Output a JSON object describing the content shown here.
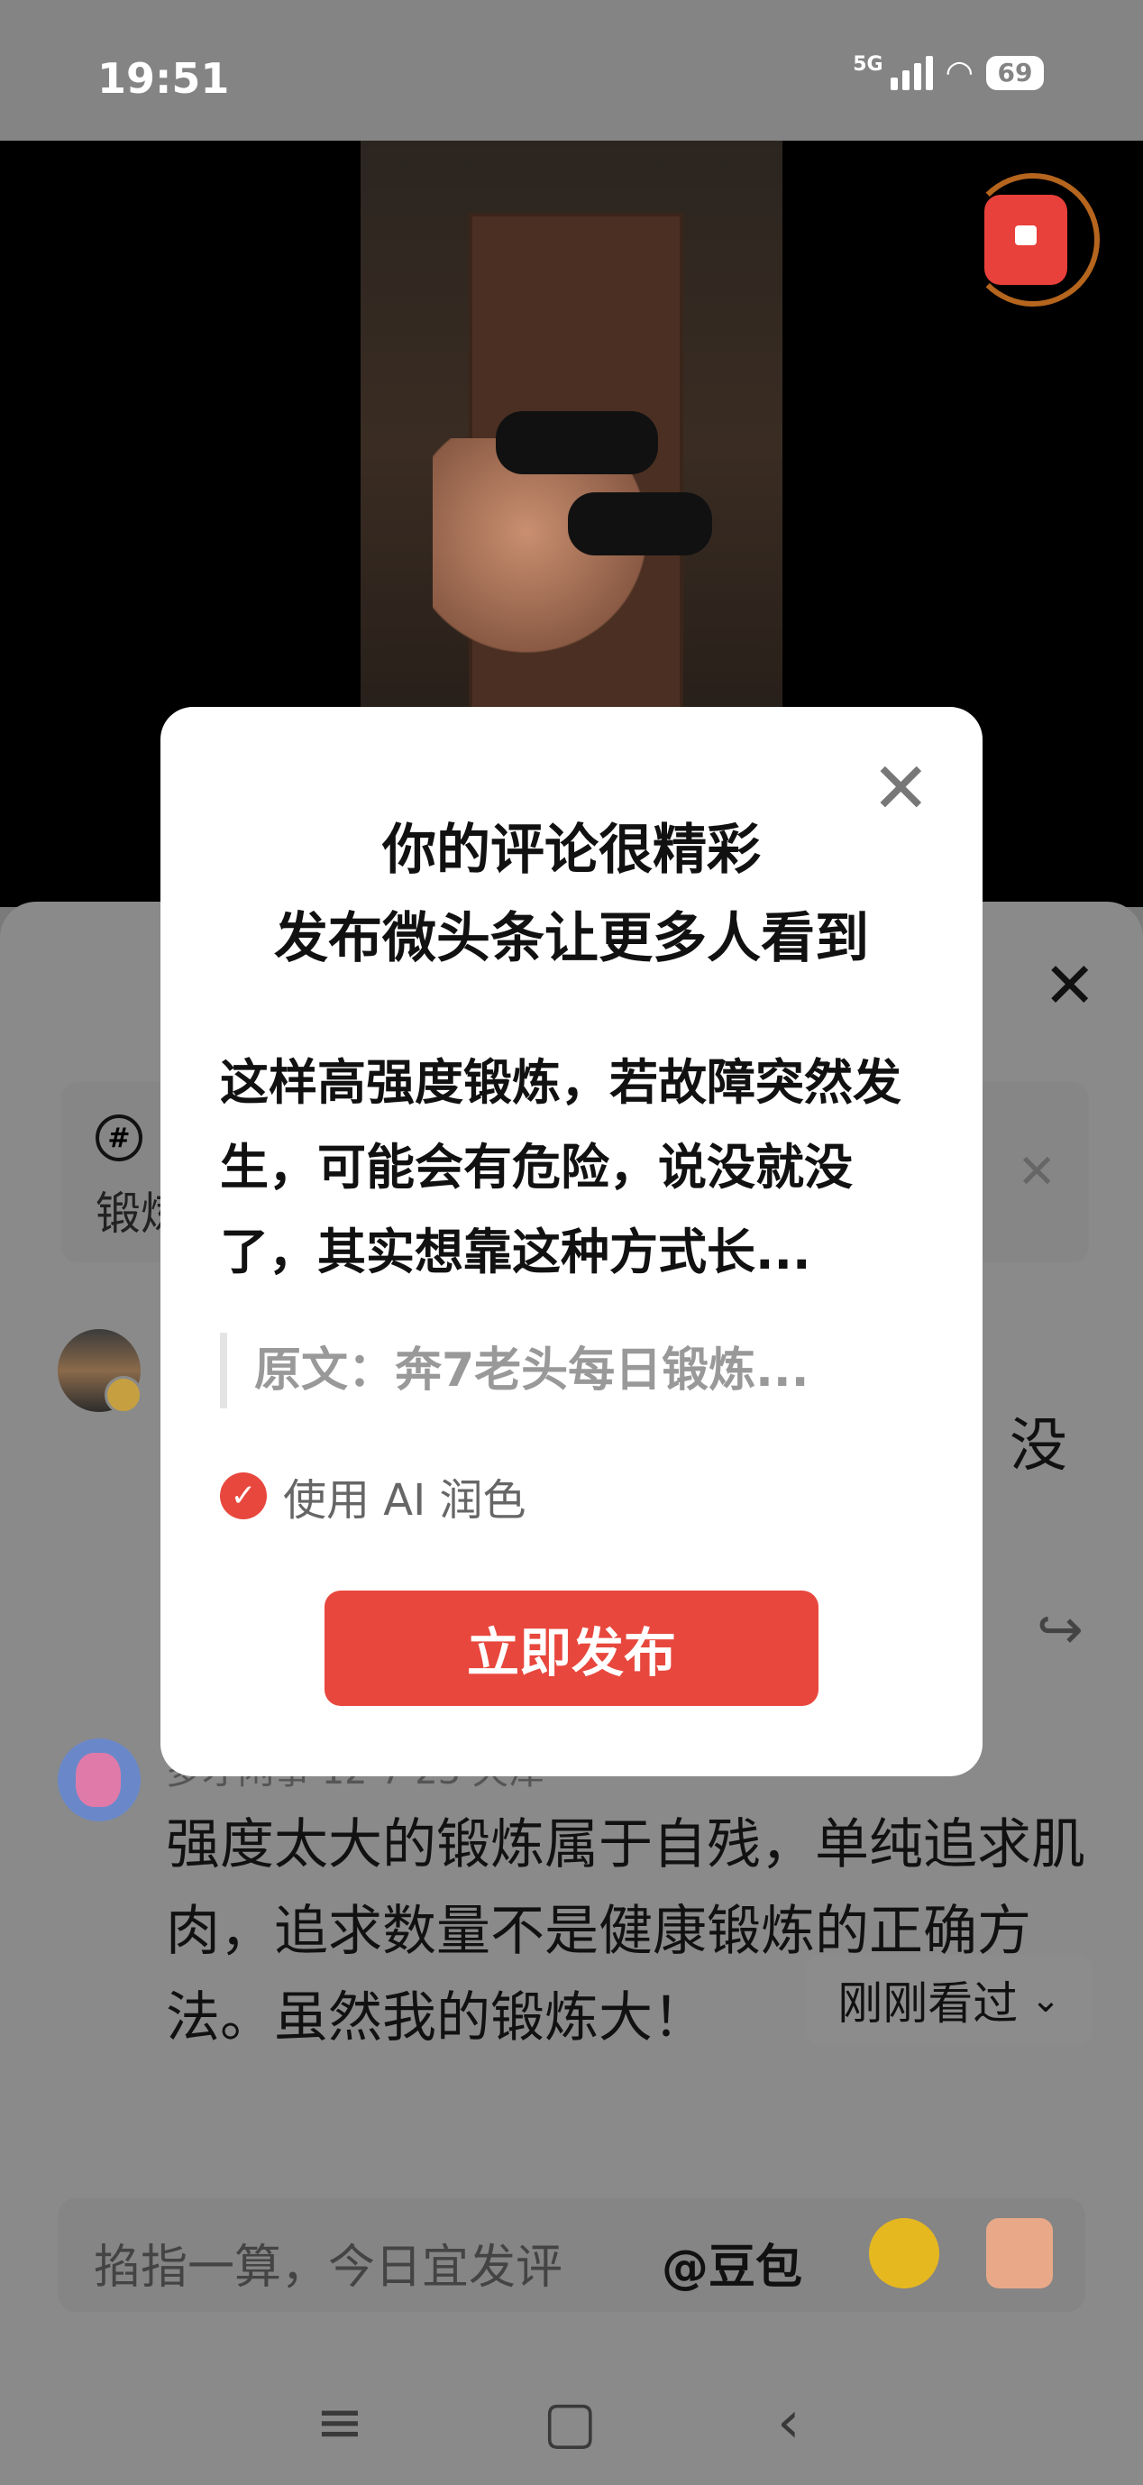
{
  "status_bar": {
    "time": "19:51",
    "network": "5G",
    "battery": "69"
  },
  "background": {
    "comment_topic": {
      "prefix": "锻炼"
    },
    "comment1": {
      "trailing_text": "没"
    },
    "comment2": {
      "meta": "多才闲事 12-7 23 天津",
      "body": "强度太大的锻炼属于自残，单纯追求肌肉，追求数量不是健康锻炼的正确方法。虽然我的锻炼大！"
    },
    "recent_button": {
      "label": "刚刚看过"
    },
    "input": {
      "placeholder": "掐指一算，今日宜发评",
      "mention": "@豆包"
    }
  },
  "dialog": {
    "title_line1": "你的评论很精彩",
    "title_line2": "发布微头条让更多人看到",
    "body": "这样高强度锻炼，若故障突然发生，可能会有危险，说没就没了，其实想靠这种方式长...",
    "quote": "原文：奔7老头每日锻炼...",
    "ai_option_label": "使用 AI 润色",
    "ai_option_checked": true,
    "publish_button": "立即发布"
  },
  "colors": {
    "accent": "#e8473d",
    "overlay": "#7a7a7a"
  }
}
